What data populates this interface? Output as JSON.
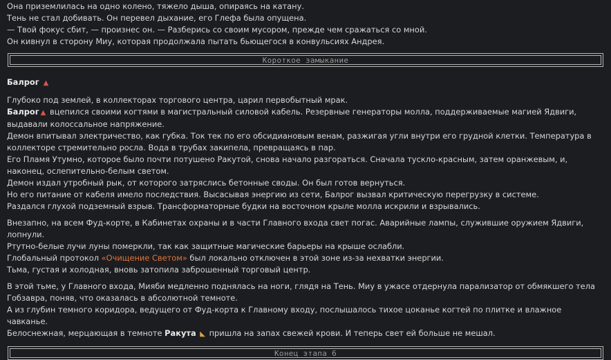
{
  "top": {
    "lines": [
      "Она приземлилась на одно колено, тяжело дыша, опираясь на катану.",
      "Тень не стал добивать. Он перевел дыхание, его Глефа была опущена.",
      "— Твой фокус сбит, — произнес он. — Разберись со своим мусором, прежде чем сражаться со мной.",
      "Он кивнул в сторону Миу, которая продолжала пытать бьющегося в конвульсиях Андрея."
    ]
  },
  "divider1": {
    "label": "Короткое замыкание"
  },
  "section": {
    "heading": "Балрог",
    "heading_icon": "fire-demon-icon",
    "p1": "Глубоко под землей, в коллекторах торгового центра, царил первобытный мрак.",
    "p2_name": "Балрог",
    "p2_rest": "вцепился своими когтями в магистральный силовой кабель. Резервные генераторы молла, поддерживаемые магией Ядвиги, выдавали колоссальное напряжение.",
    "p3": "Демон впитывал электричество, как губка. Ток тек по его обсидиановым венам, разжигая угли внутри его грудной клетки. Температура в коллекторе стремительно росла. Вода в трубах закипела, превращаясь в пар.",
    "p4": "Его Пламя Утумно, которое было почти потушено Ракутой, снова начало разгораться. Сначала тускло-красным, затем оранжевым, и, наконец, ослепительно-белым светом.",
    "p5": "Демон издал утробный рык, от которого затряслись бетонные своды. Он был готов вернуться.",
    "p6": "Но его питание от кабеля имело последствия. Высасывая энергию из сети, Балрог вызвал критическую перегрузку в системе.",
    "p7": "Раздался глухой подземный взрыв. Трансформаторные будки на восточном крыле молла искрили и взрывались.",
    "p8": "Внезапно, на всем Фуд-корте, в Кабинетах охраны и в части Главного входа свет погас. Аварийные лампы, служившие оружием Ядвиги, лопнули.",
    "p9": "Ртутно-белые лучи луны померкли, так как защитные магические барьеры на крыше ослабли.",
    "p10_a": "Глобальный протокол",
    "p10_accent": "«Очищение Светом»",
    "p10_b": "был локально отключен в этой зоне из-за нехватки энергии.",
    "p11": "Тьма, густая и холодная, вновь затопила заброшенный торговый центр.",
    "p12": "В этой тьме, у Главного входа, Мияби медленно поднялась на ноги, глядя на Тень. Миу в ужасе отдернула парализатор от обмякшего тела Гобзавра, поняв, что оказалась в абсолютной темноте.",
    "p13": "А из глубин темного коридора, ведущего от Фуд-корта к Главному входу, послышалось тихое цоканье когтей по плитке и влажное чавканье.",
    "p14_a": "Белоснежная, мерцающая в темноте",
    "p14_name": "Ракута",
    "p14_icon": "fox-icon",
    "p14_b": "пришла на запах свежей крови. И теперь свет ей больше не мешал."
  },
  "divider2": {
    "label": "Конец этапа 6"
  },
  "colors": {
    "background": "#1c1d20",
    "text": "#d7d7d7",
    "accent": "#e0743a",
    "border": "#b9b9b9"
  }
}
